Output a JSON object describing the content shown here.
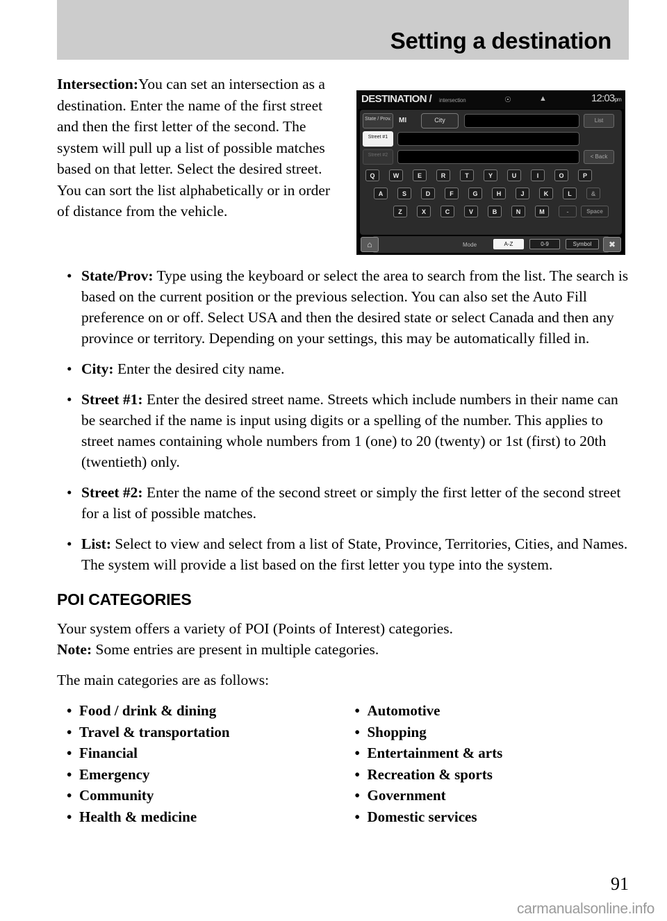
{
  "header": {
    "title": "Setting a destination",
    "band_color": "#cccccc"
  },
  "intro": {
    "term": "Intersection:",
    "body": "You can set an intersection as a destination. Enter the name of the first street and then the first letter of the second. The system will pull up a list of possible matches based on that letter. Select the desired street. You can sort the list alphabetically or in order of distance from the vehicle."
  },
  "nav_screen": {
    "title": "DESTINATION /",
    "subtitle": "intersection",
    "icon_compass": "compass-icon",
    "icon_signal": "signal-icon",
    "time": "12:03",
    "time_ampm": "pm",
    "row1": {
      "state_label": "State / Prov.",
      "state_value": "MI",
      "city_label": "City",
      "list_button": "List"
    },
    "row2": {
      "street1_label": "Street #1",
      "street1_value": "",
      "street1_cursor": "▮▮▮▮"
    },
    "row3": {
      "street2_label": "Street #2",
      "street2_value": "",
      "back_button": "< Back"
    },
    "keyboard_row1": [
      "Q",
      "W",
      "E",
      "R",
      "T",
      "Y",
      "U",
      "I",
      "O",
      "P"
    ],
    "keyboard_row2": [
      "A",
      "S",
      "D",
      "F",
      "G",
      "H",
      "J",
      "K",
      "L"
    ],
    "keyboard_row2_extra": "&",
    "keyboard_row3": [
      "Z",
      "X",
      "C",
      "V",
      "B",
      "N",
      "M"
    ],
    "keyboard_row3_dash": "-",
    "keyboard_space": "Space",
    "mode_label": "Mode",
    "mode_buttons": [
      "A-Z",
      "0-9",
      "Symbol"
    ],
    "mode_active": "A-Z",
    "home_button": "home-icon",
    "expand_button": "expand-icon"
  },
  "bullets": [
    {
      "term": "State/Prov:",
      "text": " Type using the keyboard or select the area to search from the list. The search is based on the current position or the previous selection. You can also set the Auto Fill preference on or off. Select USA and then the desired state or select Canada and then any province or territory. Depending on your settings, this may be automatically filled in."
    },
    {
      "term": "City:",
      "text": " Enter the desired city name."
    },
    {
      "term": "Street #1:",
      "text": " Enter the desired street name. Streets which include numbers in their name can be searched if the name is input using digits or a spelling of the number. This applies to street names containing whole numbers from 1 (one) to 20 (twenty) or 1st (first) to 20th (twentieth) only."
    },
    {
      "term": "Street #2:",
      "text": " Enter the name of the second street or simply the first letter of the second street for a list of possible matches."
    },
    {
      "term": "List:",
      "text": " Select to view and select from a list of State, Province, Territories, Cities, and Names. The system will provide a list based on the first letter you type into the system."
    }
  ],
  "poi": {
    "heading": "POI CATEGORIES",
    "intro_line": "Your system offers a variety of POI (Points of Interest) categories.",
    "note_term": "Note:",
    "note_text": " Some entries are present in multiple categories.",
    "lead_in": "The main categories are as follows:",
    "categories_left": [
      "Food / drink & dining",
      "Travel & transportation",
      "Financial",
      "Emergency",
      "Community",
      "Health & medicine"
    ],
    "categories_right": [
      "Automotive",
      "Shopping",
      "Entertainment & arts",
      "Recreation & sports",
      "Government",
      "Domestic services"
    ]
  },
  "footer": {
    "page_number": "91",
    "watermark": "carmanualsonline.info"
  },
  "bullet_glyph": "•"
}
